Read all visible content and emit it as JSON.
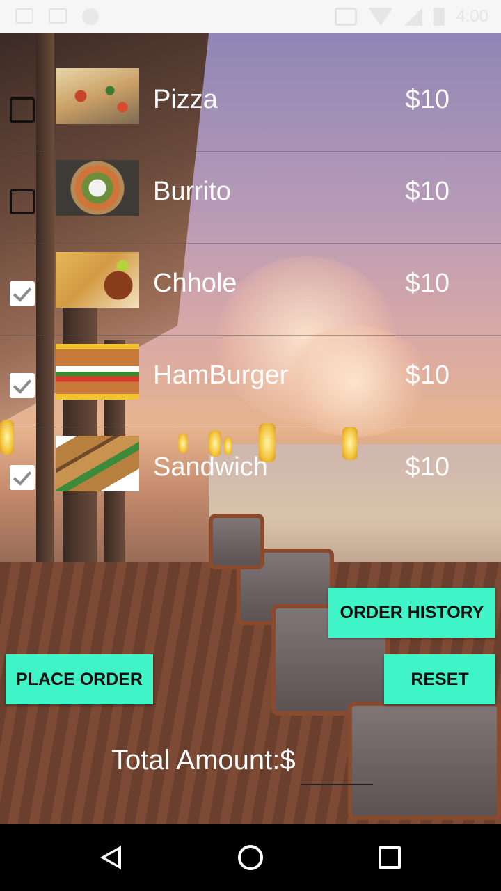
{
  "status_bar": {
    "time": "4:00",
    "icons": [
      "image-icon",
      "mail-icon",
      "app-icon",
      "vibrate-icon",
      "wifi-icon",
      "signal-icon",
      "battery-icon"
    ]
  },
  "menu": {
    "items": [
      {
        "name": "Pizza",
        "price": "$10",
        "checked": false,
        "image": "pizza"
      },
      {
        "name": "Burrito",
        "price": "$10",
        "checked": false,
        "image": "burrito"
      },
      {
        "name": "Chhole",
        "price": "$10",
        "checked": true,
        "image": "chhole"
      },
      {
        "name": "HamBurger",
        "price": "$10",
        "checked": true,
        "image": "hamburger"
      },
      {
        "name": "Sandwich",
        "price": "$10",
        "checked": true,
        "image": "sandwich"
      }
    ]
  },
  "buttons": {
    "order_history": "ORDER HISTORY",
    "place_order": "PLACE ORDER",
    "reset": "RESET"
  },
  "total": {
    "label": "Total Amount:$",
    "value": ""
  },
  "colors": {
    "button_bg": "#3ff5c7",
    "text": "#ffffff"
  },
  "nav_bar": {
    "icons": [
      "back-icon",
      "home-icon",
      "recent-apps-icon"
    ]
  }
}
